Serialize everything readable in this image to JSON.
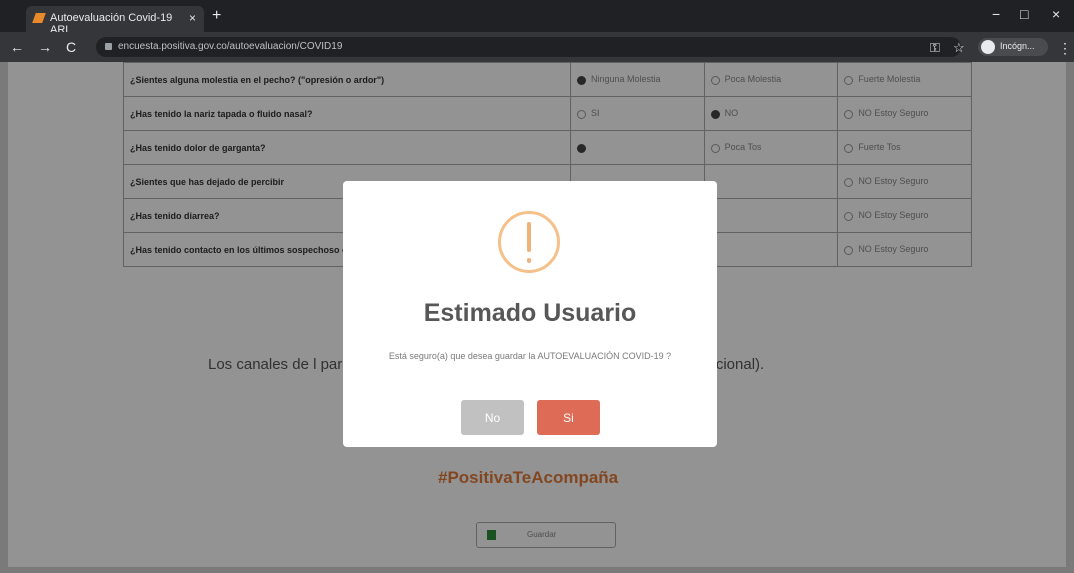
{
  "browser": {
    "tab_title": "Autoevaluación Covid-19 ARL",
    "tab_close": "×",
    "new_tab": "+",
    "url": "encuesta.positiva.gov.co/autoevaluacion/COVID19",
    "profile_label": "Incógn...",
    "nav_back": "←",
    "nav_forward": "→",
    "nav_reload": "C",
    "minimize": "−",
    "maximize": "□",
    "close": "×",
    "star": "☆",
    "key": "⚿",
    "menu": "⋮"
  },
  "questions": [
    {
      "text": "¿Sientes alguna molestia en el pecho? (\"opresión o ardor\")",
      "options": [
        "Ninguna Molestia",
        "Poca Molestia",
        "Fuerte Molestia"
      ],
      "selected": 0
    },
    {
      "text": "¿Has tenido la nariz tapada o fluido nasal?",
      "options": [
        "SI",
        "NO",
        "NO Estoy Seguro"
      ],
      "selected": 1
    },
    {
      "text": "¿Has tenido dolor de garganta?",
      "options": [
        "",
        "Poca Tos",
        "Fuerte Tos"
      ],
      "selected": 0
    },
    {
      "text": "¿Sientes que has dejado de percibir",
      "options": [
        "",
        "",
        "NO Estoy Seguro"
      ],
      "selected": -1
    },
    {
      "text": "¿Has tenido diarrea?",
      "options": [
        "",
        "",
        "NO Estoy Seguro"
      ],
      "selected": -1
    },
    {
      "text": "¿Has tenido contacto en los últimos sospechoso o confirmado de tener",
      "options": [
        "",
        "",
        "NO Estoy Seguro"
      ],
      "selected": -1
    }
  ],
  "paragraph": "Los canales de                                                          l para detección del COVID-19 son l                                                           18000955590 (Línea nacional).",
  "hashtag": "#PositivaTeAcompaña",
  "footer_button": "Guardar",
  "modal": {
    "title": "Estimado Usuario",
    "message": "Está seguro(a) que desea guardar la AUTOEVALUACIÓN COVID-19 ?",
    "no_label": "No",
    "yes_label": "Si"
  },
  "colors": {
    "accent": "#e07a3a",
    "confirm": "#dd6b55",
    "cancel": "#c1c1c1",
    "warning": "#f5c089"
  }
}
